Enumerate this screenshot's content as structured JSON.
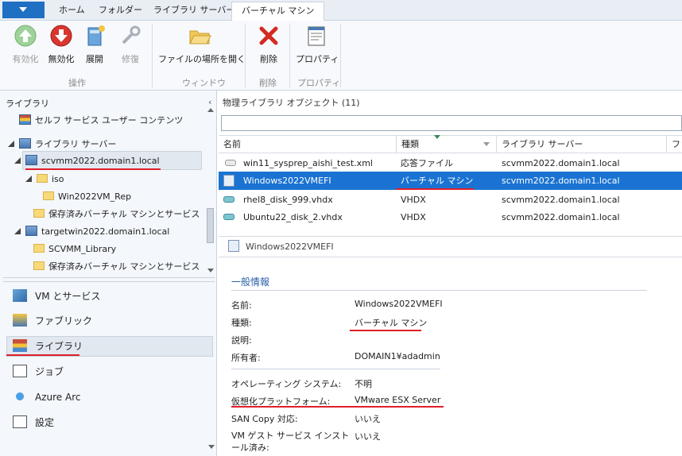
{
  "tabs": [
    "ホーム",
    "フォルダー",
    "ライブラリ サーバー",
    "バーチャル マシン"
  ],
  "active_tab": 3,
  "ribbon": {
    "buttons": [
      {
        "label": "有効化",
        "enabled": false,
        "icon": "green-up-arrow-icon"
      },
      {
        "label": "無効化",
        "enabled": true,
        "icon": "red-down-arrow-icon"
      },
      {
        "label": "展開",
        "enabled": true,
        "icon": "deploy-icon"
      },
      {
        "label": "修復",
        "enabled": false,
        "icon": "wrench-icon"
      },
      {
        "label": "ファイルの場所を開く",
        "enabled": true,
        "icon": "folder-open-icon"
      },
      {
        "label": "削除",
        "enabled": true,
        "icon": "red-x-icon"
      },
      {
        "label": "プロパティ",
        "enabled": true,
        "icon": "properties-icon"
      }
    ],
    "groups": [
      "操作",
      "ウィンドウ",
      "削除",
      "プロパティ"
    ]
  },
  "left": {
    "header": "ライブラリ",
    "tree": [
      "セルフ サービス ユーザー コンテンツ",
      "ライブラリ サーバー",
      "scvmm2022.domain1.local",
      "iso",
      "Win2022VM_Rep",
      "保存済みバーチャル マシンとサービス",
      "targetwin2022.domain1.local",
      "SCVMM_Library",
      "保存済みバーチャル マシンとサービス"
    ],
    "nav": [
      "VM とサービス",
      "ファブリック",
      "ライブラリ",
      "ジョブ",
      "Azure Arc",
      "設定"
    ]
  },
  "right": {
    "header": "物理ライブラリ オブジェクト (11)",
    "columns": [
      "名前",
      "種類",
      "ライブラリ サーバー",
      "ファ"
    ],
    "rows": [
      {
        "name": "win11_sysprep_aishi_test.xml",
        "type": "応答ファイル",
        "server": "scvmm2022.domain1.local"
      },
      {
        "name": "Windows2022VMEFI",
        "type": "バーチャル マシン",
        "server": "scvmm2022.domain1.local"
      },
      {
        "name": "rhel8_disk_999.vhdx",
        "type": "VHDX",
        "server": "scvmm2022.domain1.local"
      },
      {
        "name": "Ubuntu22_disk_2.vhdx",
        "type": "VHDX",
        "server": "scvmm2022.domain1.local"
      }
    ],
    "detail_title": "Windows2022VMEFI",
    "section": "一般情報",
    "props": [
      {
        "label": "名前:",
        "value": "Windows2022VMEFI"
      },
      {
        "label": "種類:",
        "value": "バーチャル マシン"
      },
      {
        "label": "説明:",
        "value": ""
      },
      {
        "label": "所有者:",
        "value": "DOMAIN1¥adadmin"
      },
      {
        "label": "オペレーティング システム:",
        "value": "不明"
      },
      {
        "label": "仮想化プラットフォーム:",
        "value": "VMware ESX Server"
      },
      {
        "label": "SAN Copy 対応:",
        "value": "いいえ"
      },
      {
        "label": "VM ゲスト サービス インストール済み:",
        "value": "いいえ"
      }
    ]
  },
  "colors": {
    "selection": "#1a73d2",
    "annotation": "#e0202a",
    "accent": "#1f6fc3"
  }
}
